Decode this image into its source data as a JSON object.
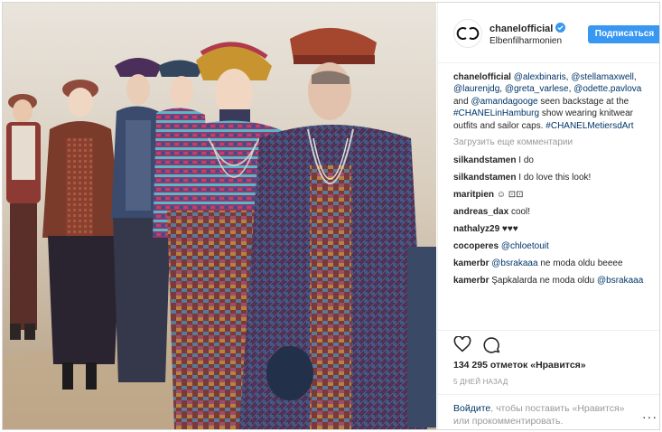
{
  "post": {
    "username": "chanelofficial",
    "location": "Elbenfilharmonien",
    "follow_label": "Подписаться",
    "caption_author": "chanelofficial",
    "caption_parts": [
      {
        "t": "@alexbinaris",
        "link": true
      },
      {
        "t": ", ",
        "link": false
      },
      {
        "t": "@stellamaxwell",
        "link": true
      },
      {
        "t": ", ",
        "link": false
      },
      {
        "t": "@laurenjdg",
        "link": true
      },
      {
        "t": ", ",
        "link": false
      },
      {
        "t": "@greta_varlese",
        "link": true
      },
      {
        "t": ", ",
        "link": false
      },
      {
        "t": "@odette.pavlova",
        "link": true
      },
      {
        "t": " and ",
        "link": false
      },
      {
        "t": "@amandagooge",
        "link": true
      },
      {
        "t": " seen backstage at the ",
        "link": false
      },
      {
        "t": "#CHANELinHamburg",
        "link": true
      },
      {
        "t": " show wearing knitwear outfits and sailor caps. ",
        "link": false
      },
      {
        "t": "#CHANELMetiersdArt",
        "link": true
      }
    ],
    "load_more": "Загрузить еще комментарии",
    "comments": [
      {
        "user": "silkandstamen",
        "parts": [
          {
            "t": "I do",
            "link": false
          }
        ]
      },
      {
        "user": "silkandstamen",
        "parts": [
          {
            "t": "I do love this look!",
            "link": false
          }
        ]
      },
      {
        "user": "maritpien",
        "parts": [
          {
            "t": "☺ ⊡⊡",
            "link": false
          }
        ]
      },
      {
        "user": "andreas_dax",
        "parts": [
          {
            "t": "cool!",
            "link": false
          }
        ]
      },
      {
        "user": "nathalyz29",
        "parts": [
          {
            "t": "♥♥♥",
            "link": false
          }
        ]
      },
      {
        "user": "cocoperes",
        "parts": [
          {
            "t": "@chloetouit",
            "link": true
          }
        ]
      },
      {
        "user": "kamerbr",
        "parts": [
          {
            "t": "@bsrakaaa",
            "link": true
          },
          {
            "t": " ne moda oldu beeee",
            "link": false
          }
        ]
      },
      {
        "user": "kamerbr",
        "parts": [
          {
            "t": "Şapkalarda ne moda oldu ",
            "link": false
          },
          {
            "t": "@bsrakaaa",
            "link": true
          }
        ]
      }
    ],
    "likes_text": "134 295 отметок «Нравится»",
    "time_ago": "5 ДНЕЙ НАЗАД",
    "login_link": "Войдите",
    "login_rest": ", чтобы поставить «Нравится» или прокомментировать.",
    "more_dots": "···"
  },
  "icons": {
    "avatar": "chanel-logo-icon",
    "verified": "verified-badge-icon",
    "like": "heart-icon",
    "comment": "comment-bubble-icon",
    "more": "more-options-icon"
  },
  "colors": {
    "follow_button": "#3897f0",
    "link": "#003569",
    "muted": "#999999",
    "text": "#262626"
  }
}
